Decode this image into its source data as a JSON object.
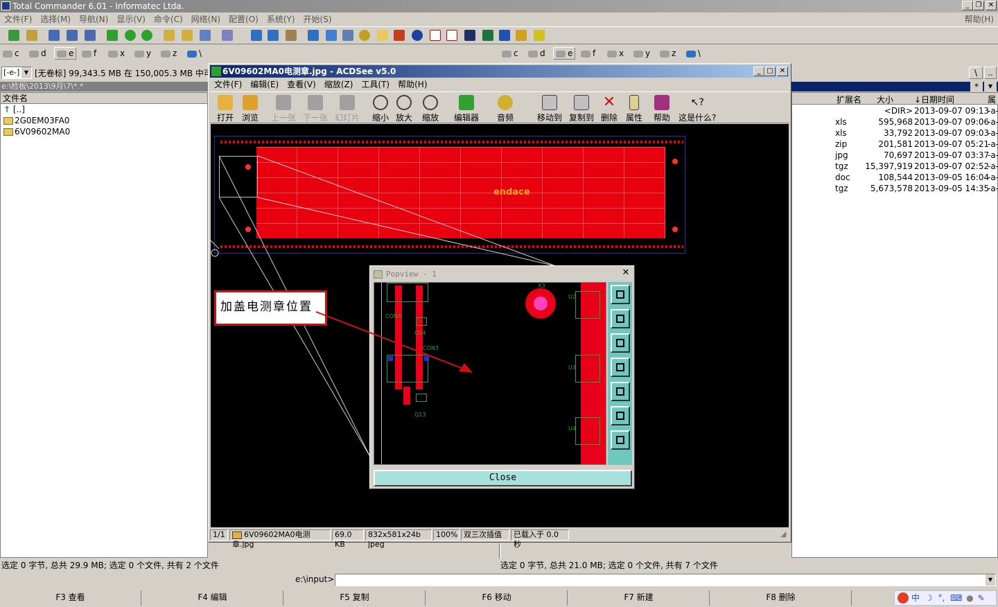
{
  "app": {
    "title": "Total Commander 6.01 - Informatec Ltda.",
    "help_menu": "帮助(H)"
  },
  "menu": [
    "文件(F)",
    "选择(M)",
    "导航(N)",
    "显示(V)",
    "命令(C)",
    "网络(N)",
    "配置(O)",
    "系统(Y)",
    "开始(S)"
  ],
  "drives_left": [
    "c",
    "d",
    "e",
    "f",
    "x",
    "y",
    "z",
    "\\"
  ],
  "drives_right": [
    "c",
    "d",
    "e",
    "f",
    "x",
    "y",
    "z",
    "\\"
  ],
  "left": {
    "drive_select": "[-e-]",
    "drive_info": "[无卷标]  99,343.5 MB 在 150,005.3 MB 中可",
    "path": "e:\\检板\\2013\\9月\\7\\*.*",
    "col_name": "文件名",
    "items": [
      "[..]",
      "2G0EM03FA0",
      "6V09602MA0"
    ],
    "status": "选定 0 字节, 总共 29.9 MB; 选定 0 个文件, 共有 2 个文件"
  },
  "right": {
    "root_btn": "\\",
    "dots_btn": "..",
    "star_btn": "*",
    "cols": {
      "ext": "扩展名",
      "size": "大小",
      "date": "↓日期时间",
      "attr": "属"
    },
    "rows": [
      {
        "ext": "",
        "size": "<DIR>",
        "date": "2013-09-07 09:13",
        "attr": "-a-"
      },
      {
        "ext": "xls",
        "size": "595,968",
        "date": "2013-09-07 09:06",
        "attr": "-a-"
      },
      {
        "ext": "xls",
        "size": "33,792",
        "date": "2013-09-07 09:03",
        "attr": "-a-"
      },
      {
        "ext": "zip",
        "size": "201,581",
        "date": "2013-09-07 05:21",
        "attr": "-a-"
      },
      {
        "ext": "jpg",
        "size": "70,697",
        "date": "2013-09-07 03:37",
        "attr": "-a-"
      },
      {
        "ext": "tgz",
        "size": "15,397,919",
        "date": "2013-09-07 02:52",
        "attr": "-a-"
      },
      {
        "ext": "doc",
        "size": "108,544",
        "date": "2013-09-05 16:04",
        "attr": "-a-"
      },
      {
        "ext": "tgz",
        "size": "5,673,578",
        "date": "2013-09-05 14:35",
        "attr": "-a-"
      }
    ],
    "status": "选定 0 字节, 总共 21.0 MB; 选定 0 个文件, 共有 7 个文件"
  },
  "acdsee": {
    "title": "6V09602MA0电测章.jpg - ACDSee v5.0",
    "menu": [
      "文件(F)",
      "编辑(E)",
      "查看(V)",
      "缩放(Z)",
      "工具(T)",
      "帮助(H)"
    ],
    "tools": [
      "打开",
      "浏览",
      "上一张",
      "下一张",
      "幻灯片",
      "缩小",
      "放大",
      "缩放",
      "编辑器",
      "音频",
      "移动到",
      "复制到",
      "删除",
      "属性",
      "帮助",
      "这是什么?"
    ],
    "status": [
      "1/1",
      "6V09602MA0电测章.jpg",
      "69.0 KB",
      "832x581x24b jpeg",
      "100%",
      "双三次插值",
      "已载入于 0.0 秒"
    ]
  },
  "image_overlay": {
    "pcb_logo": "endace",
    "callout": "加盖电测章位置",
    "popview_title": "Popview - 1",
    "popview_close": "Close",
    "labels": [
      "X3",
      "U2",
      "CON4",
      "Q14",
      "CON3",
      "U3",
      "Q13",
      "U4"
    ]
  },
  "cmd": {
    "path": "e:\\input>"
  },
  "fkeys": [
    "F3 查看",
    "F4 编辑",
    "F5 复制",
    "F6 移动",
    "F7 新建",
    "F8 删除"
  ],
  "tray": [
    "中"
  ]
}
